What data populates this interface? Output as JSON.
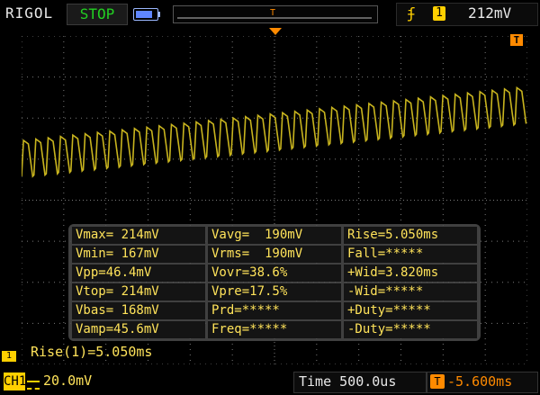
{
  "header": {
    "brand": "RIGOL",
    "run_state": "STOP",
    "trigger_edge_icon": "rising-edge-icon",
    "trigger_channel": "1",
    "trigger_level": "212mV",
    "memory_marker": "T"
  },
  "screen": {
    "trigger_marker": "T"
  },
  "measurements": [
    [
      "Vmax= 214mV",
      "Vavg=  190mV",
      "Rise=5.050ms"
    ],
    [
      "Vmin= 167mV",
      "Vrms=  190mV",
      "Fall=*****"
    ],
    [
      "Vpp=46.4mV",
      "Vovr=38.6%",
      "+Wid=3.820ms"
    ],
    [
      "Vtop= 214mV",
      "Vpre=17.5%",
      "-Wid=*****"
    ],
    [
      "Vbas= 168mV",
      "Prd=*****",
      "+Duty=*****"
    ],
    [
      "Vamp=45.6mV",
      "Freq=*****",
      "-Duty=*****"
    ]
  ],
  "rise_readout": "Rise(1)=5.050ms",
  "footer": {
    "channel": "CH1",
    "volts_per_div": "20.0mV",
    "timebase": "Time 500.0us",
    "trigger_offset": "-5.600ms"
  },
  "colors": {
    "trace": "#c8b41e",
    "measure_text": "#ffe35a",
    "run_state": "#22d022",
    "trigger_accent": "#ff8a00",
    "grid": "#7a7a7a"
  }
}
